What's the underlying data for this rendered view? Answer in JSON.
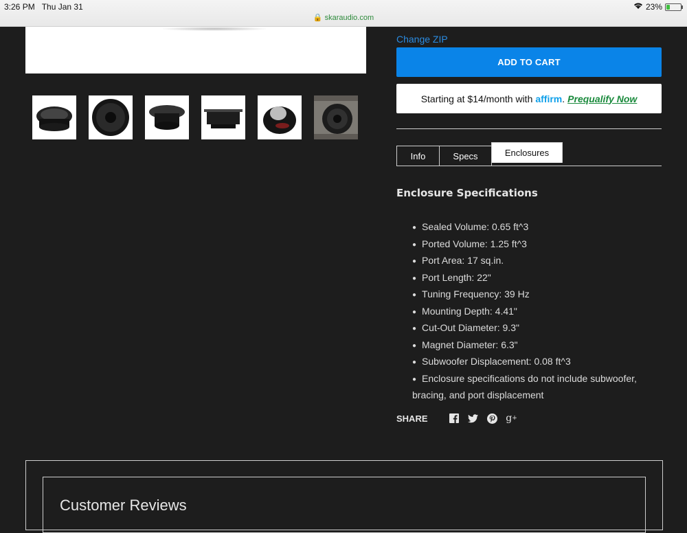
{
  "status": {
    "time": "3:26 PM",
    "date": "Thu Jan 31",
    "battery": "23%",
    "battery_level": 0.23
  },
  "browser": {
    "url": "skaraudio.com"
  },
  "product": {
    "change_zip": "Change ZIP",
    "add_to_cart": "ADD TO CART",
    "affirm": {
      "prefix": "Starting at $14/month with",
      "brand": "affirm",
      "separator": ".",
      "link": "Prequalify Now"
    },
    "thumbnails": [
      "thumbnail-1",
      "thumbnail-2",
      "thumbnail-3",
      "thumbnail-4",
      "thumbnail-5",
      "thumbnail-6"
    ]
  },
  "tabs": [
    {
      "label": "Info",
      "active": false
    },
    {
      "label": "Specs",
      "active": false
    },
    {
      "label": "Enclosures",
      "active": true
    }
  ],
  "enclosure": {
    "title": "Enclosure Specifications",
    "specs": [
      "Sealed Volume: 0.65 ft^3",
      "Ported Volume: 1.25 ft^3",
      "Port Area: 17 sq.in.",
      "Port Length: 22\"",
      "Tuning Frequency: 39 Hz",
      "Mounting Depth: 4.41\"",
      "Cut-Out Diameter: 9.3\"",
      "Magnet Diameter: 6.3\"",
      "Subwoofer Displacement: 0.08 ft^3",
      "Enclosure specifications do not include subwoofer, bracing, and port displacement"
    ]
  },
  "share": {
    "label": "SHARE",
    "icons": [
      "facebook-icon",
      "twitter-icon",
      "pinterest-icon",
      "google-plus-icon"
    ]
  },
  "reviews": {
    "title": "Customer Reviews"
  }
}
